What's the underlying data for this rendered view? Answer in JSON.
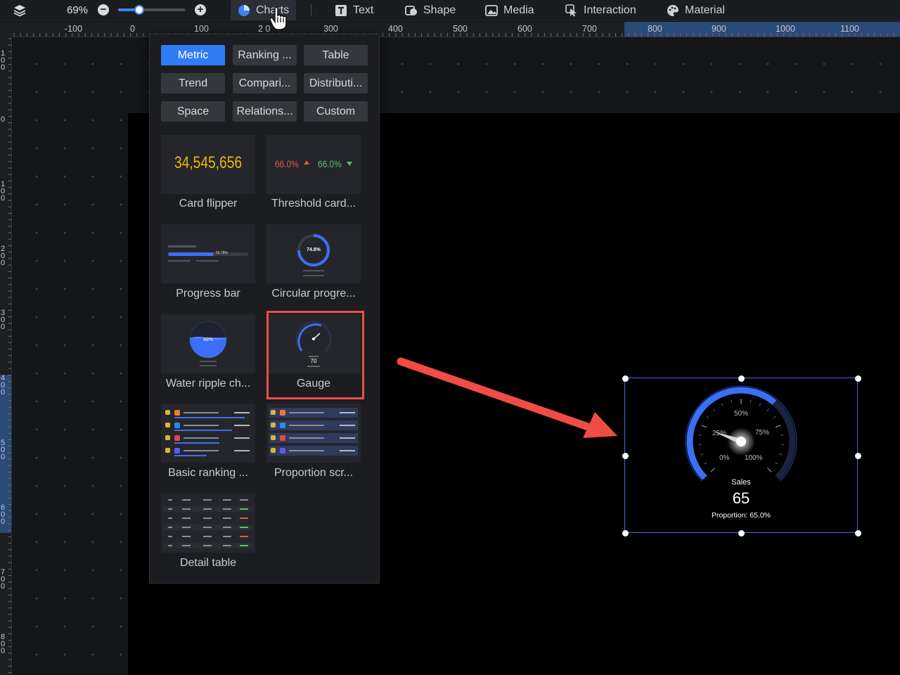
{
  "toolbar": {
    "zoom": "69%",
    "zoom_out_icon": "minus-circle-icon",
    "zoom_in_icon": "plus-circle-icon",
    "zoom_level": 0.31,
    "items": [
      {
        "label": "Charts",
        "icon": "pie-chart-icon"
      },
      {
        "label": "Text",
        "icon": "text-icon"
      },
      {
        "label": "Shape",
        "icon": "shape-icon"
      },
      {
        "label": "Media",
        "icon": "image-icon"
      },
      {
        "label": "Interaction",
        "icon": "pointer-icon"
      },
      {
        "label": "Material",
        "icon": "palette-icon"
      }
    ]
  },
  "ruler": {
    "horizontal": [
      "-100",
      "0",
      "100",
      "2 0",
      "300",
      "400",
      "500",
      "600",
      "700",
      "800",
      "900",
      "1000",
      "1100"
    ],
    "vertical": [
      "1 0 0",
      "0",
      "1 0 0",
      "2 0 0",
      "3 0 0",
      "4 0 0",
      "5 0 0",
      "6 0 0",
      "7 0 0",
      "8 0 0"
    ]
  },
  "panel": {
    "categories": [
      "Metric",
      "Ranking ...",
      "Table",
      "Trend",
      "Compari...",
      "Distributi...",
      "Space",
      "Relations...",
      "Custom"
    ],
    "selected_category": "Metric",
    "widgets": [
      {
        "label": "Card flipper",
        "preview": "34,545,656"
      },
      {
        "label": "Threshold card...",
        "preview_up": "66.0%",
        "preview_down": "66.0%"
      },
      {
        "label": "Progress bar",
        "preview": "65.78%"
      },
      {
        "label": "Circular progre...",
        "preview": "74.8%"
      },
      {
        "label": "Water ripple ch...",
        "preview": "48%"
      },
      {
        "label": "Gauge",
        "preview": "70"
      },
      {
        "label": "Basic ranking ..."
      },
      {
        "label": "Proportion scr..."
      },
      {
        "label": "Detail table"
      }
    ]
  },
  "gauge": {
    "title": "Sales",
    "value": "65",
    "proportion": "Proportion: 65.0%",
    "ticks": [
      "0%",
      "25%",
      "50%",
      "75%",
      "100%"
    ],
    "fill_fraction": 0.65,
    "color": "#3b6ff5"
  }
}
